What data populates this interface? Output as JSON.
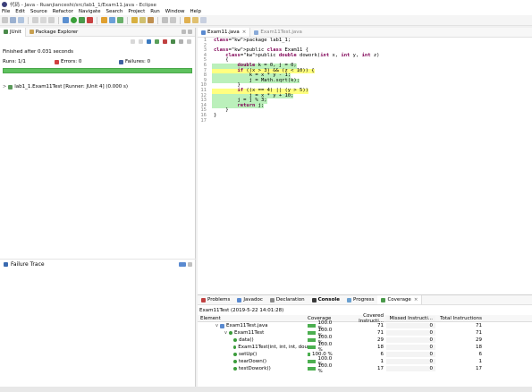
{
  "window": {
    "title": "代码 - Java - Ruanjianceshi/src/lab1_1/Exam11.java - Eclipse"
  },
  "menu": [
    "File",
    "Edit",
    "Source",
    "Refactor",
    "Navigate",
    "Search",
    "Project",
    "Run",
    "Window",
    "Help"
  ],
  "left": {
    "tabs": [
      "JUnit",
      "Package Explorer"
    ],
    "finished": "Finished after 0.031 seconds",
    "runs_label": "Runs:",
    "runs_value": "1/1",
    "errors_label": "Errors:",
    "errors_value": "0",
    "failures_label": "Failures:",
    "failures_value": "0",
    "test_item": "lab1_1.Exam11Test [Runner: JUnit 4] (0.000 s)",
    "failure_trace": "Failure Trace"
  },
  "editor": {
    "tabs": [
      "Exam11.java",
      "Exam11Test.java"
    ],
    "lines": [
      {
        "n": "1",
        "t": "package lab1_1;",
        "h": ""
      },
      {
        "n": "2",
        "t": "",
        "h": ""
      },
      {
        "n": "3",
        "t": "public class Exam11 {",
        "h": ""
      },
      {
        "n": "4",
        "t": "    public double dowork(int x, int y, int z)",
        "h": ""
      },
      {
        "n": "5",
        "t": "    {",
        "h": ""
      },
      {
        "n": "6",
        "t": "        double k = 0, j = 0;",
        "h": "gr"
      },
      {
        "n": "7",
        "t": "        if ((x > 3) && (z < 10)) {",
        "h": "hl"
      },
      {
        "n": "8",
        "t": "            k = x * y - 1;",
        "h": "gr"
      },
      {
        "n": "9",
        "t": "            j = Math.sqrt(k);",
        "h": "gr"
      },
      {
        "n": "10",
        "t": "        }",
        "h": ""
      },
      {
        "n": "11",
        "t": "        if ((x == 4) || (y > 5))",
        "h": "hl"
      },
      {
        "n": "12",
        "t": "            j = x * y + 10;",
        "h": "gr"
      },
      {
        "n": "13",
        "t": "        j = j % 3;",
        "h": "gr"
      },
      {
        "n": "14",
        "t": "        return j;",
        "h": "gr"
      },
      {
        "n": "15",
        "t": "    }",
        "h": ""
      },
      {
        "n": "16",
        "t": "}",
        "h": ""
      },
      {
        "n": "17",
        "t": "",
        "h": ""
      }
    ]
  },
  "bottom": {
    "tabs": [
      "Problems",
      "Javadoc",
      "Declaration",
      "Console",
      "Progress",
      "Coverage"
    ],
    "session": "Exam11Test (2019-5-22 14:01:28)",
    "headers": [
      "Element",
      "Coverage",
      "Covered Instructi...",
      "Missed Instructi...",
      "Total Instructions"
    ],
    "rows": [
      {
        "name": "Exam11Test.java",
        "cov": "100.0 %",
        "covered": "71",
        "missed": "0",
        "total": "71"
      },
      {
        "name": "Exam11Test",
        "cov": "100.0 %",
        "covered": "71",
        "missed": "0",
        "total": "71"
      },
      {
        "name": "data()",
        "cov": "100.0 %",
        "covered": "29",
        "missed": "0",
        "total": "29"
      },
      {
        "name": "Exam11Test(int, int, int, dou",
        "cov": "100.0 %",
        "covered": "18",
        "missed": "0",
        "total": "18"
      },
      {
        "name": "setUp()",
        "cov": "100.0 %",
        "covered": "6",
        "missed": "0",
        "total": "6"
      },
      {
        "name": "tearDown()",
        "cov": "100.0 %",
        "covered": "1",
        "missed": "0",
        "total": "1"
      },
      {
        "name": "testDowork()",
        "cov": "100.0 %",
        "covered": "17",
        "missed": "0",
        "total": "17"
      }
    ]
  },
  "colors": {
    "green": "#5ec15e",
    "keyword": "#7f0055"
  }
}
